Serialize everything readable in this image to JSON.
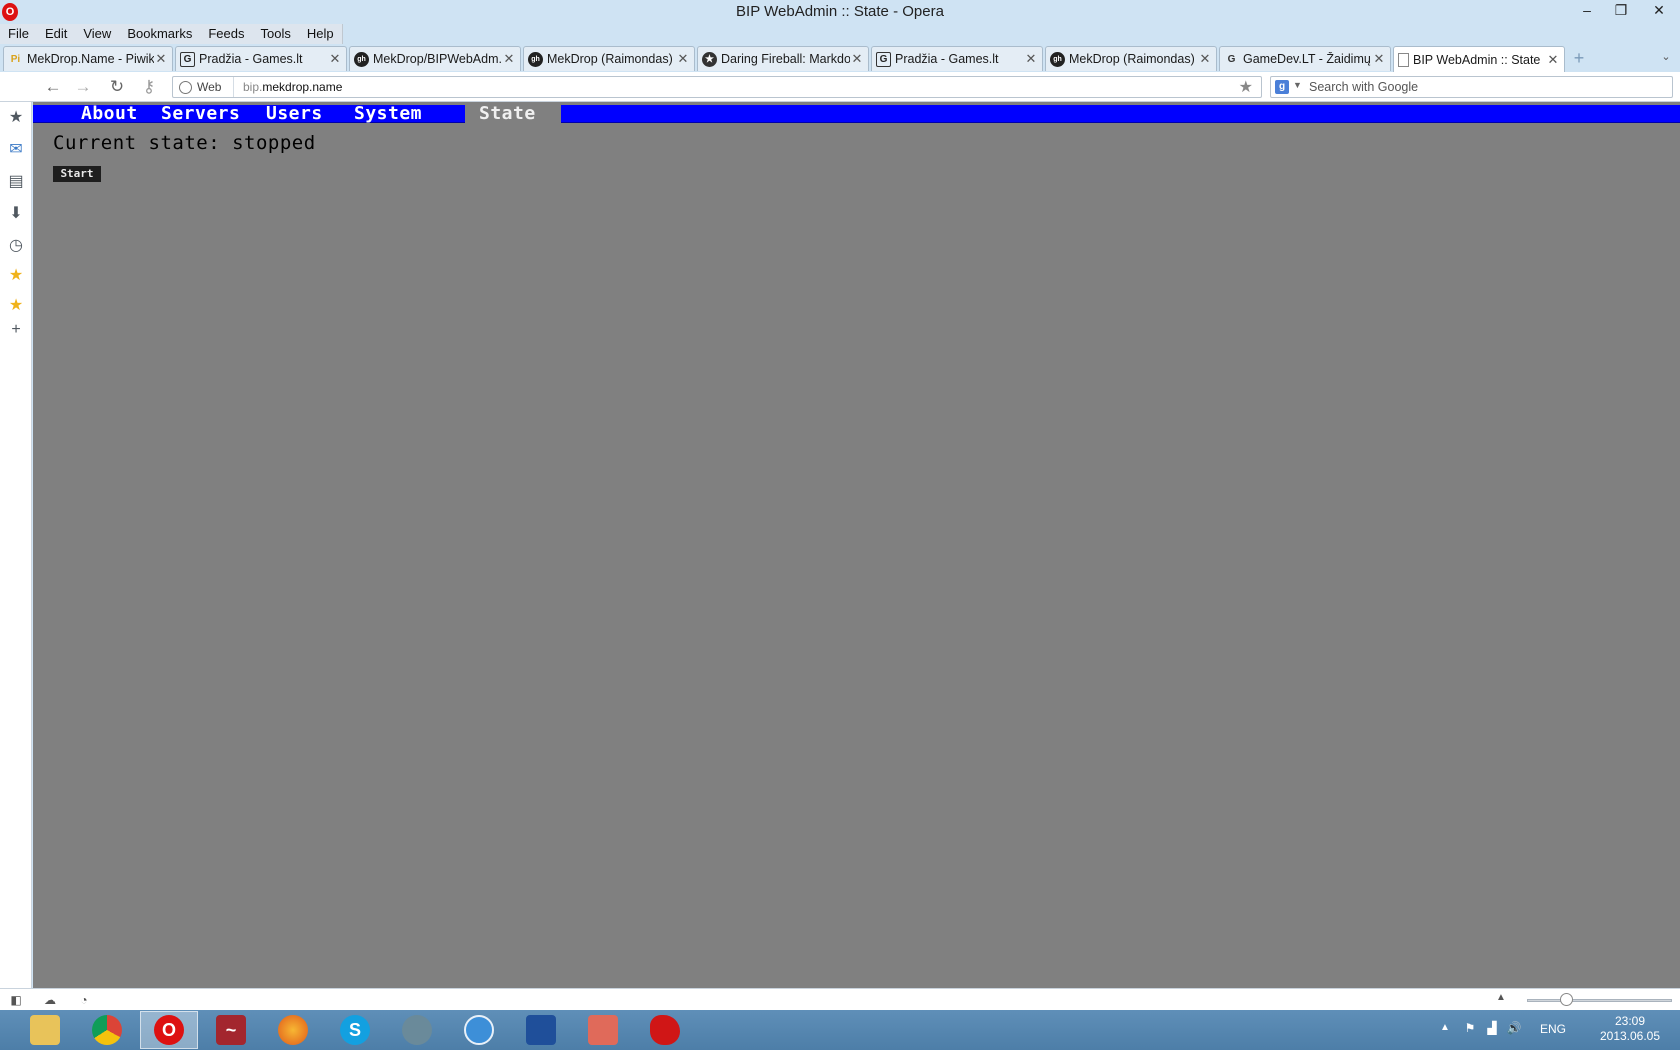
{
  "window": {
    "title": "BIP WebAdmin :: State - Opera",
    "controls": {
      "minimize": "–",
      "restore": "❐",
      "close": "✕"
    }
  },
  "menubar": [
    "File",
    "Edit",
    "View",
    "Bookmarks",
    "Feeds",
    "Tools",
    "Help"
  ],
  "tabs": [
    {
      "label": "MekDrop.Name - Piwik...",
      "favicon": "Pi"
    },
    {
      "label": "Pradžia - Games.lt",
      "favicon": "G"
    },
    {
      "label": "MekDrop/BIPWebAdm...",
      "favicon": "gh"
    },
    {
      "label": "MekDrop (Raimondas)",
      "favicon": "gh"
    },
    {
      "label": "Daring Fireball: Markdo...",
      "favicon": "★"
    },
    {
      "label": "Pradžia - Games.lt",
      "favicon": "G"
    },
    {
      "label": "MekDrop (Raimondas)",
      "favicon": "gh"
    },
    {
      "label": "GameDev.LT - Žaidimų...",
      "favicon": "G"
    },
    {
      "label": "BIP WebAdmin :: State",
      "favicon": "doc",
      "active": true
    }
  ],
  "address": {
    "chip_label": "Web",
    "url_prefix": "bip.",
    "url_domain": "mekdrop.name",
    "search_placeholder": "Search with Google"
  },
  "site": {
    "nav": [
      "About",
      "Servers",
      "Users",
      "System",
      "State"
    ],
    "current_nav": "State",
    "heading": "Current state: stopped",
    "start_button": "Start",
    "colors": {
      "nav_bg": "#0000ff",
      "page_bg": "#808080"
    }
  },
  "tray": {
    "language": "ENG",
    "time": "23:09",
    "date": "2013.06.05"
  }
}
